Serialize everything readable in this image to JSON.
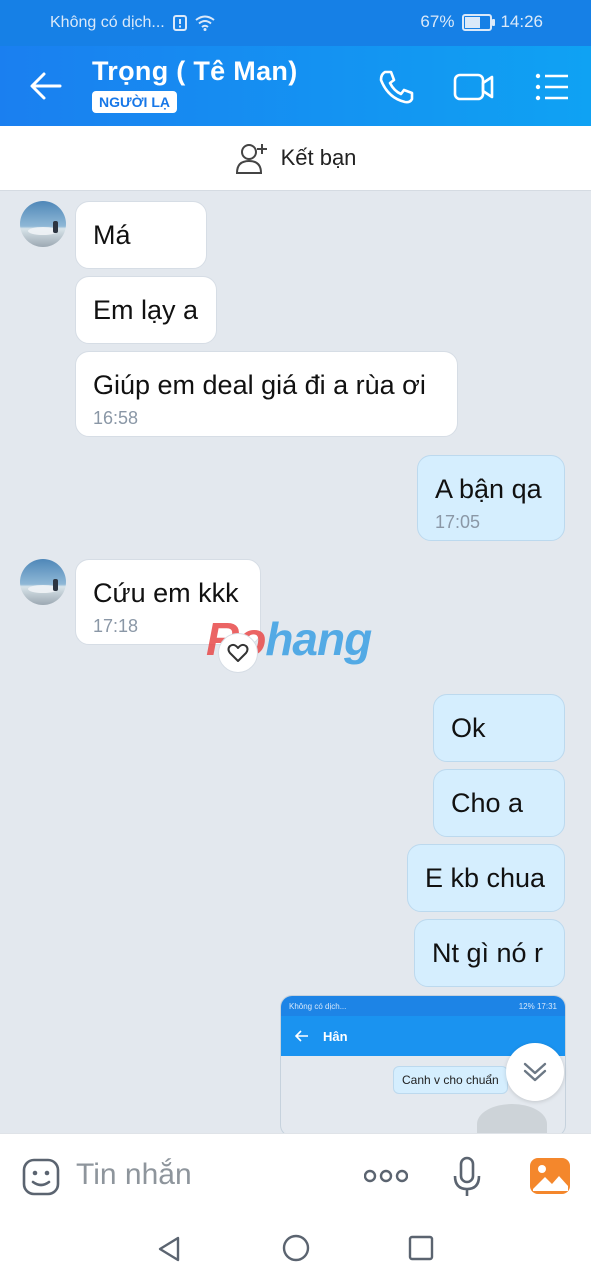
{
  "status_bar": {
    "carrier": "Không có dịch...",
    "battery": "67%",
    "battery_level": 0.67,
    "time": "14:26"
  },
  "header": {
    "title": "Trọng ( Tê Man)",
    "badge": "NGƯỜI LẠ",
    "icons": [
      "back-arrow-icon",
      "phone-icon",
      "video-call-icon",
      "menu-list-icon"
    ]
  },
  "friend_bar": {
    "label": "Kết bạn"
  },
  "messages": [
    {
      "dir": "in",
      "text": "Má"
    },
    {
      "dir": "in",
      "text": "Em lạy a"
    },
    {
      "dir": "in",
      "text": "Giúp em deal giá đi a rùa ơi",
      "time": "16:58"
    },
    {
      "dir": "out",
      "text": "A bận qa",
      "time": "17:05"
    },
    {
      "dir": "in",
      "text": "Cứu em kkk",
      "time": "17:18",
      "reaction": "heart-icon"
    },
    {
      "dir": "out",
      "text": "Ok"
    },
    {
      "dir": "out",
      "text": "Cho a"
    },
    {
      "dir": "out",
      "text": "E kb chua"
    },
    {
      "dir": "out",
      "text": "Nt gì nó r"
    }
  ],
  "watermark": {
    "part1": "Ro",
    "part2": "hang"
  },
  "shared_image": {
    "status_left": "Không có dịch...",
    "status_right": "12%  17:31",
    "chat_title": "Hân",
    "bubble_text": "Canh v cho chuẩn"
  },
  "input_bar": {
    "placeholder": "Tin nhắn"
  },
  "colors": {
    "header_start": "#1a7ff0",
    "header_end": "#0fa2f3",
    "outgoing_bubble": "#d5eefe",
    "chat_bg": "#e3e8ee"
  }
}
